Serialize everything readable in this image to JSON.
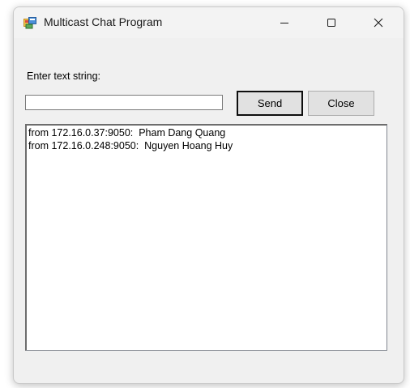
{
  "window": {
    "title": "Multicast Chat Program",
    "icon": "app-window-icon"
  },
  "caption_buttons": {
    "minimize_icon": "minimize-icon",
    "maximize_icon": "maximize-icon",
    "close_icon": "close-icon"
  },
  "form": {
    "label": "Enter text string:",
    "input_value": "",
    "send_label": "Send",
    "close_label": "Close"
  },
  "messages": [
    "from 172.16.0.37:9050:  Pham Dang Quang",
    "from 172.16.0.248:9050:  Nguyen Hoang Huy"
  ],
  "colors": {
    "window_bg": "#f0f0f0",
    "titlebar_bg": "#f3f3f3",
    "button_bg": "#e1e1e1",
    "list_bg": "#ffffff"
  }
}
